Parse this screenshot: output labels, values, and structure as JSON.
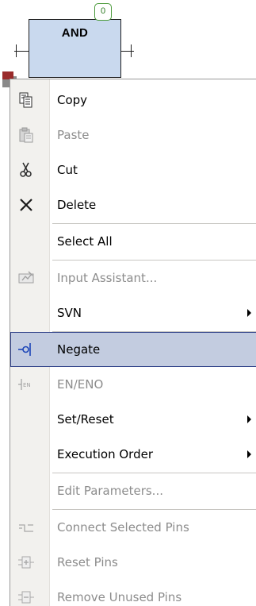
{
  "block": {
    "title": "AND",
    "execution_order": "0"
  },
  "menu": {
    "items": [
      {
        "label": "Copy",
        "icon": "copy-icon",
        "enabled": true
      },
      {
        "label": "Paste",
        "icon": "paste-icon",
        "enabled": false
      },
      {
        "label": "Cut",
        "icon": "scissors-icon",
        "enabled": true
      },
      {
        "label": "Delete",
        "icon": "delete-x-icon",
        "enabled": true
      },
      {
        "label": "Select All",
        "icon": "",
        "enabled": true
      },
      {
        "label": "Input Assistant...",
        "icon": "input-assistant-icon",
        "enabled": false
      },
      {
        "label": "SVN",
        "icon": "",
        "enabled": true,
        "submenu": true
      },
      {
        "label": "Negate",
        "icon": "negate-icon",
        "enabled": true,
        "highlighted": true
      },
      {
        "label": "EN/ENO",
        "icon": "en-eno-icon",
        "enabled": false
      },
      {
        "label": "Set/Reset",
        "icon": "",
        "enabled": true,
        "submenu": true
      },
      {
        "label": "Execution Order",
        "icon": "",
        "enabled": true,
        "submenu": true
      },
      {
        "label": "Edit Parameters...",
        "icon": "",
        "enabled": false
      },
      {
        "label": "Connect Selected Pins",
        "icon": "connect-pins-icon",
        "enabled": false
      },
      {
        "label": "Reset Pins",
        "icon": "reset-pins-icon",
        "enabled": false
      },
      {
        "label": "Remove Unused Pins",
        "icon": "remove-pins-icon",
        "enabled": false
      }
    ]
  },
  "colors": {
    "block_fill": "#c9d9ee",
    "highlight_fill": "#c3cce0",
    "highlight_border": "#34458b",
    "badge_green": "#4a9a3a",
    "disabled_text": "#8c8c8c"
  }
}
